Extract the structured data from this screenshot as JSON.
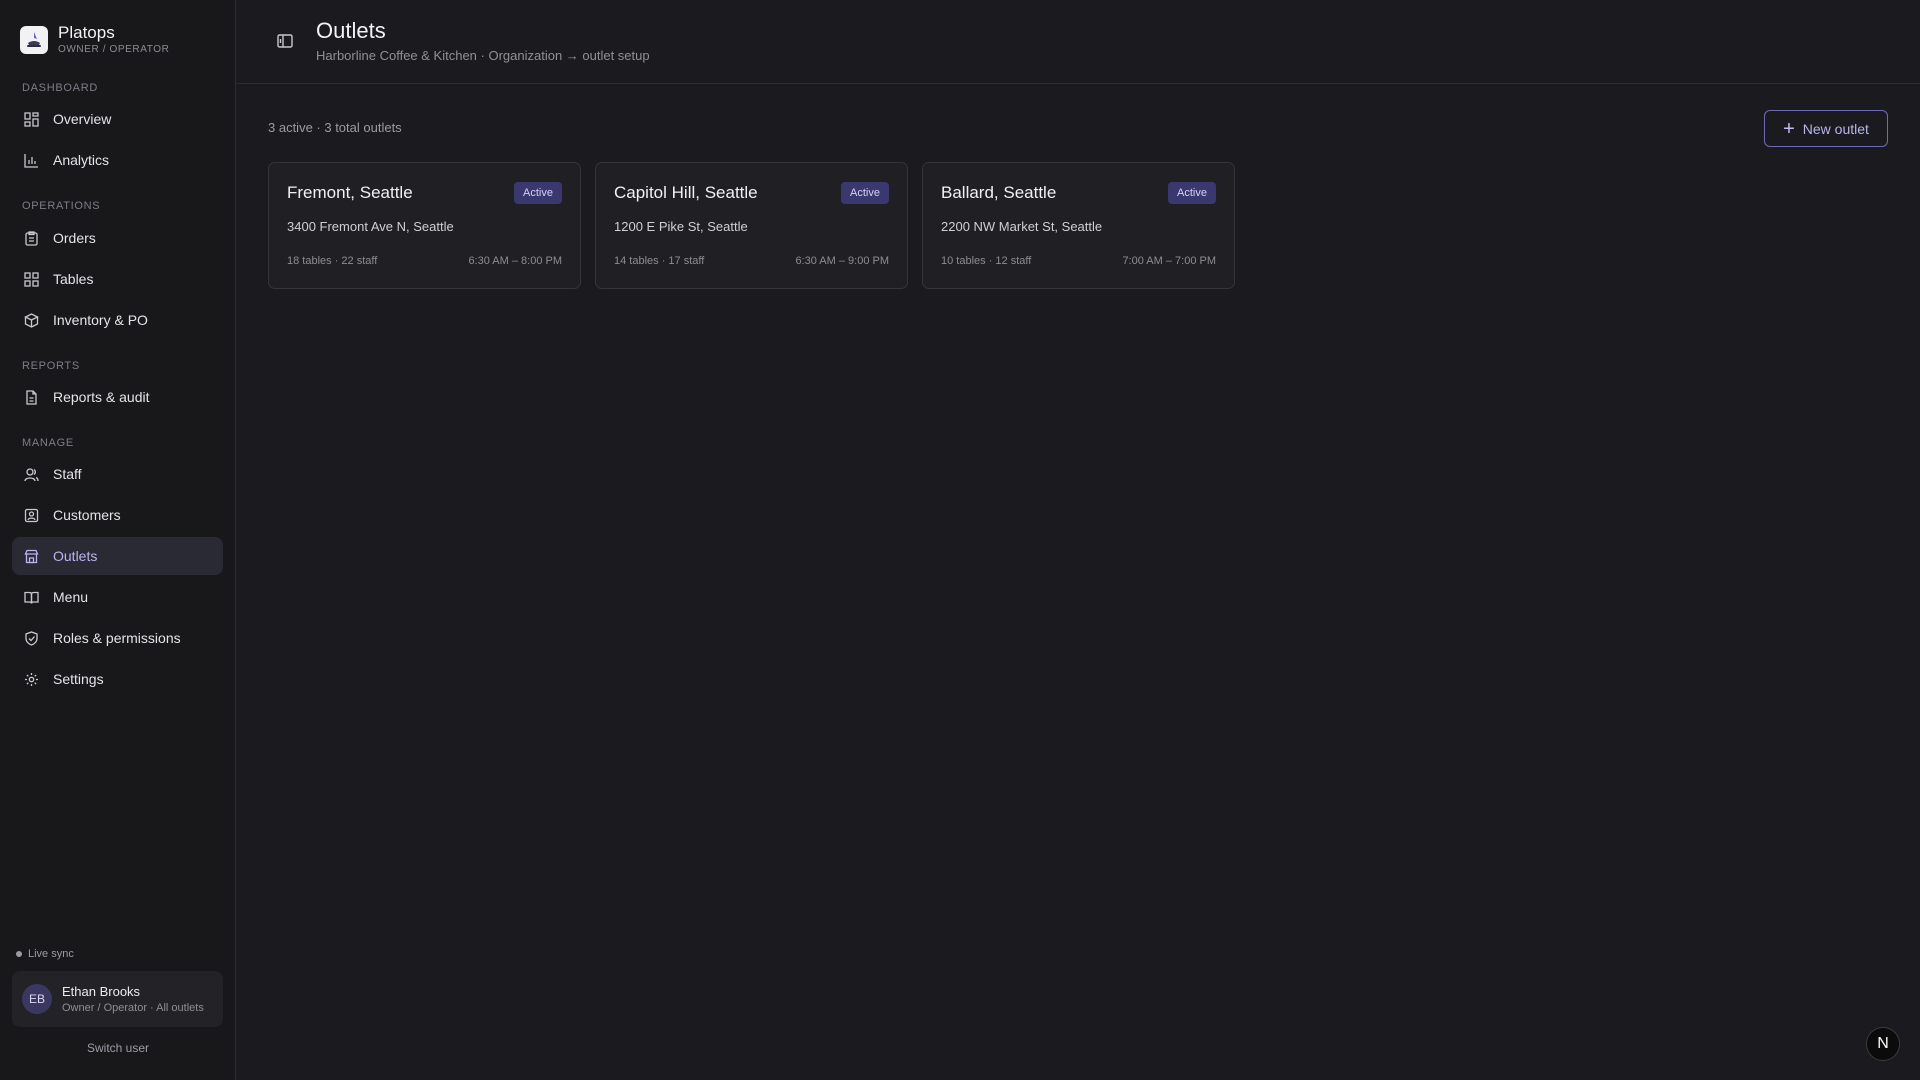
{
  "brand": {
    "name": "Platops",
    "role": "OWNER / OPERATOR"
  },
  "sidebar": {
    "sections": [
      {
        "title": "DASHBOARD"
      },
      {
        "title": "OPERATIONS"
      },
      {
        "title": "REPORTS"
      },
      {
        "title": "MANAGE"
      }
    ],
    "items": [
      {
        "label": "Overview",
        "icon": "grid-icon"
      },
      {
        "label": "Analytics",
        "icon": "bar-chart-icon"
      },
      {
        "label": "Orders",
        "icon": "clipboard-icon"
      },
      {
        "label": "Tables",
        "icon": "grid-icon"
      },
      {
        "label": "Inventory & PO",
        "icon": "boxes-icon"
      },
      {
        "label": "Reports & audit",
        "icon": "file-icon"
      },
      {
        "label": "Staff",
        "icon": "users-icon"
      },
      {
        "label": "Customers",
        "icon": "contact-icon"
      },
      {
        "label": "Outlets",
        "icon": "store-icon",
        "active": true
      },
      {
        "label": "Menu",
        "icon": "book-icon"
      },
      {
        "label": "Roles & permissions",
        "icon": "shield-icon"
      },
      {
        "label": "Settings",
        "icon": "gear-icon"
      }
    ],
    "live_sync": "Live sync",
    "user": {
      "initials": "EB",
      "name": "Ethan Brooks",
      "meta": "Owner / Operator · All outlets"
    },
    "switch_user": "Switch user"
  },
  "header": {
    "title": "Outlets",
    "breadcrumb": "Harborline Coffee & Kitchen · Organization → outlet setup"
  },
  "main": {
    "summary": "3 active · 3 total outlets",
    "new_button": "New outlet",
    "outlets": [
      {
        "name": "Fremont, Seattle",
        "status": "Active",
        "address": "3400 Fremont Ave N, Seattle",
        "stats": "18 tables · 22 staff",
        "hours": "6:30 AM – 8:00 PM"
      },
      {
        "name": "Capitol Hill, Seattle",
        "status": "Active",
        "address": "1200 E Pike St, Seattle",
        "stats": "14 tables · 17 staff",
        "hours": "6:30 AM – 9:00 PM"
      },
      {
        "name": "Ballard, Seattle",
        "status": "Active",
        "address": "2200 NW Market St, Seattle",
        "stats": "10 tables · 12 staff",
        "hours": "7:00 AM – 7:00 PM"
      }
    ]
  },
  "fab": {
    "label": "N"
  },
  "colors": {
    "accent": "#b9b4f0",
    "badge_bg": "#3b3870",
    "background": "#1b1b1f",
    "sidebar": "#18181b"
  }
}
